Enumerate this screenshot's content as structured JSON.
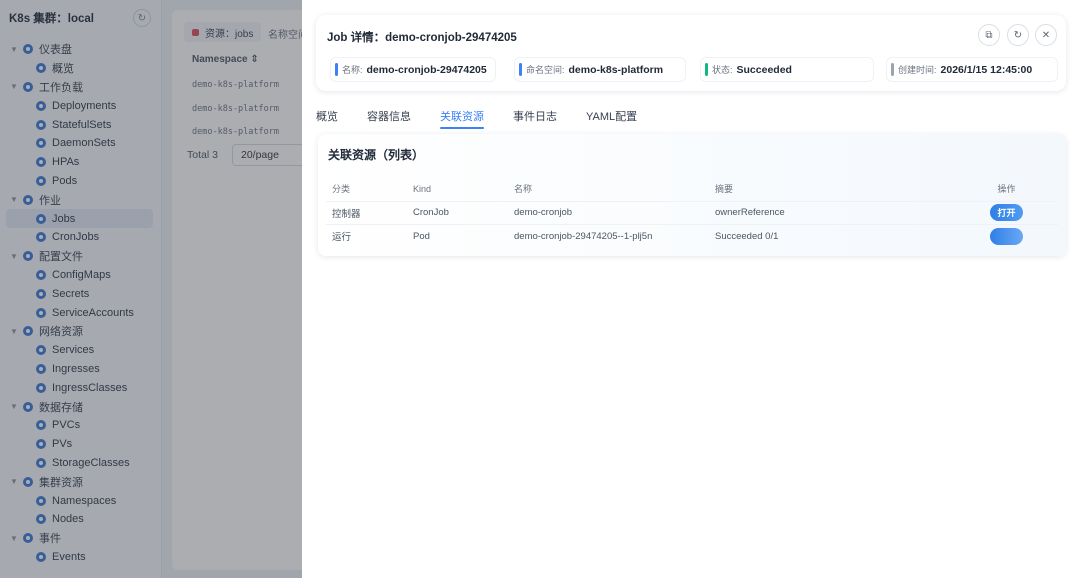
{
  "sidebar": {
    "title": "K8s 集群：local",
    "refresh_icon": "refresh-icon",
    "groups": [
      {
        "label": "仪表盘",
        "items": [
          {
            "label": "概览"
          }
        ]
      },
      {
        "label": "工作负载",
        "items": [
          {
            "label": "Deployments"
          },
          {
            "label": "StatefulSets"
          },
          {
            "label": "DaemonSets"
          },
          {
            "label": "HPAs"
          },
          {
            "label": "Pods"
          }
        ]
      },
      {
        "label": "作业",
        "items": [
          {
            "label": "Jobs",
            "active": true
          },
          {
            "label": "CronJobs"
          }
        ]
      },
      {
        "label": "配置文件",
        "items": [
          {
            "label": "ConfigMaps"
          },
          {
            "label": "Secrets"
          },
          {
            "label": "ServiceAccounts"
          }
        ]
      },
      {
        "label": "网络资源",
        "items": [
          {
            "label": "Services"
          },
          {
            "label": "Ingresses"
          },
          {
            "label": "IngressClasses"
          }
        ]
      },
      {
        "label": "数据存储",
        "items": [
          {
            "label": "PVCs"
          },
          {
            "label": "PVs"
          },
          {
            "label": "StorageClasses"
          }
        ]
      },
      {
        "label": "集群资源",
        "items": [
          {
            "label": "Namespaces"
          },
          {
            "label": "Nodes"
          }
        ]
      },
      {
        "label": "事件",
        "items": [
          {
            "label": "Events"
          }
        ]
      }
    ]
  },
  "background": {
    "resource_tag": "资源：jobs",
    "namespace_tag": "名称空间",
    "column_header": "Namespace ⇕",
    "rows": [
      "demo-k8s-platform",
      "demo-k8s-platform",
      "demo-k8s-platform"
    ],
    "total": "Total 3",
    "page_size": "20/page"
  },
  "drawer": {
    "title": "Job 详情：demo-cronjob-29474205",
    "info": [
      {
        "key": "名称:",
        "value": "demo-cronjob-29474205",
        "color": "#3b82f6"
      },
      {
        "key": "命名空间:",
        "value": "demo-k8s-platform",
        "color": "#3b82f6"
      },
      {
        "key": "状态:",
        "value": "Succeeded",
        "color": "#10b981"
      },
      {
        "key": "创建时间:",
        "value": "2026/1/15 12:45:00",
        "color": "#9ca3af"
      }
    ],
    "tabs": [
      "概览",
      "容器信息",
      "关联资源",
      "事件日志",
      "YAML配置"
    ],
    "active_tab": "关联资源",
    "resources": {
      "title": "关联资源（列表）",
      "columns": [
        "分类",
        "Kind",
        "名称",
        "摘要",
        "操作"
      ],
      "rows": [
        {
          "category": "控制器",
          "kind": "CronJob",
          "name": "demo-cronjob",
          "summary": "ownerReference",
          "action": "打开"
        },
        {
          "category": "运行",
          "kind": "Pod",
          "name": "demo-cronjob-29474205--1-plj5n",
          "summary": "Succeeded 0/1",
          "action": ""
        }
      ]
    }
  }
}
